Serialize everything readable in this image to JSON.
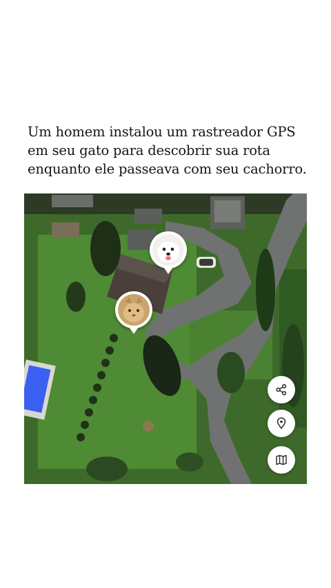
{
  "post": {
    "caption_lines": [
      "Um homem instalou um rastreador GPS",
      "em seu gato para descobrir sua rota",
      "enquanto ele passeava com seu cachorro."
    ]
  },
  "map": {
    "markers": [
      {
        "name": "dog-marker",
        "icon": "dog-face"
      },
      {
        "name": "cat-marker",
        "icon": "cat-face"
      }
    ],
    "controls": [
      {
        "name": "share-button",
        "icon": "share-icon"
      },
      {
        "name": "location-pin-button",
        "icon": "map-pin-icon"
      },
      {
        "name": "map-view-button",
        "icon": "folded-map-icon"
      }
    ],
    "colors": {
      "grass": "#4f8a34",
      "pool": "#3b5ff0",
      "road": "#6f7270",
      "roof": "#4a3f3a"
    }
  }
}
